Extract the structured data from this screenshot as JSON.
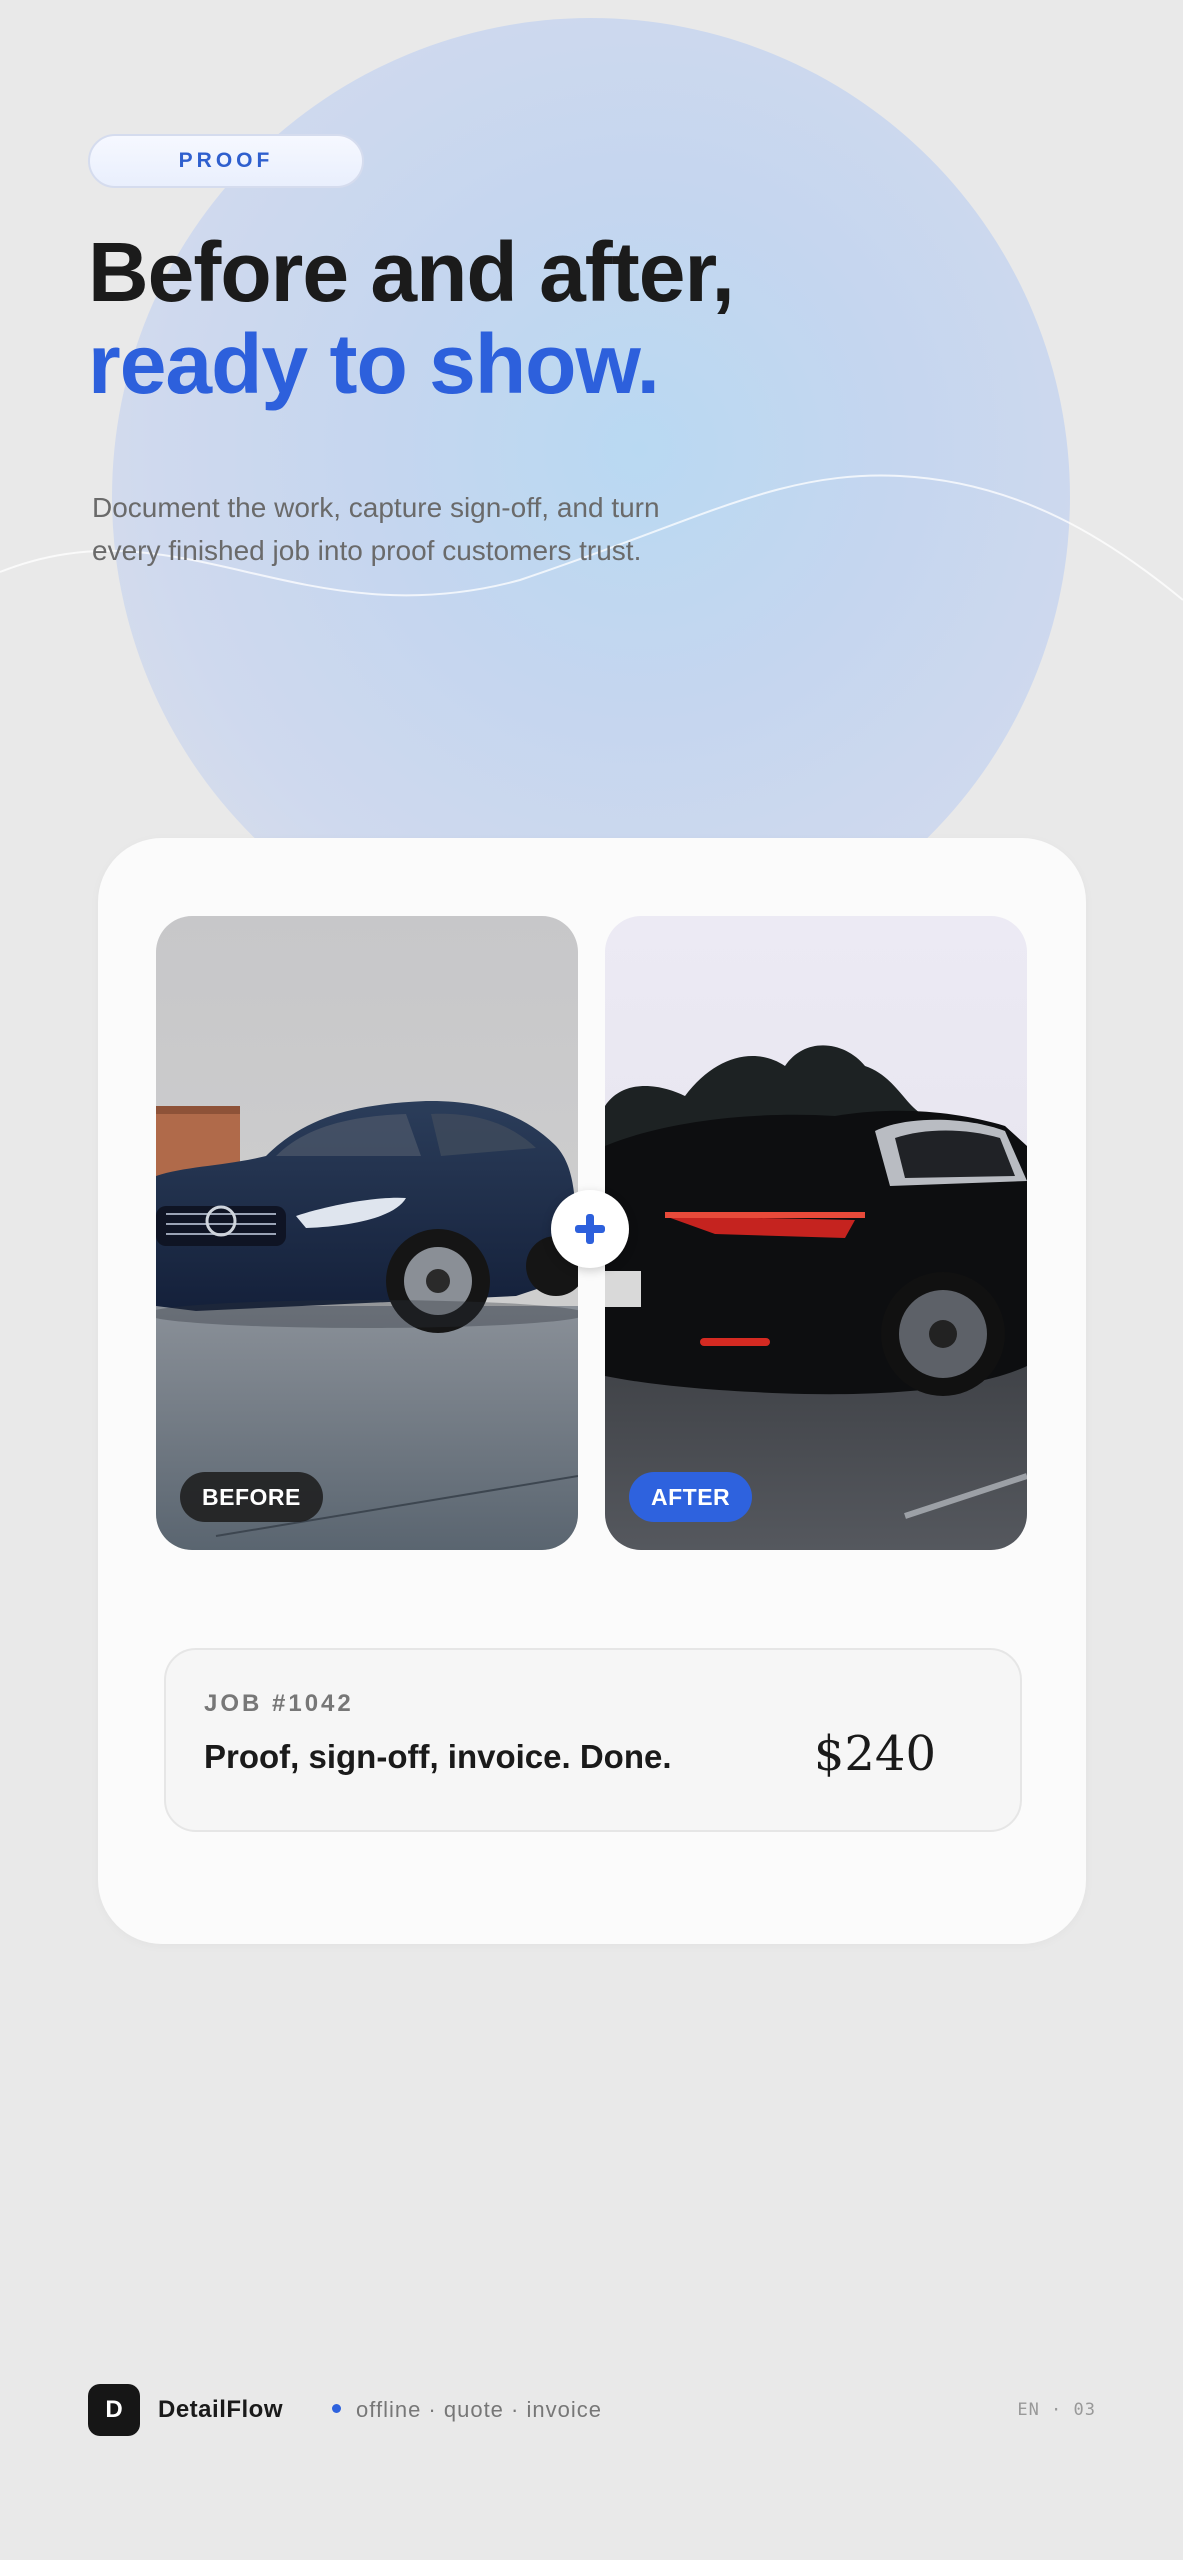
{
  "hero": {
    "badge": "PROOF",
    "headline_line1": "Before and after,",
    "headline_line2": "ready to show.",
    "subtitle_line1": "Document the work, capture sign-off, and turn",
    "subtitle_line2": "every finished job into proof customers trust."
  },
  "comparison": {
    "before_label": "BEFORE",
    "after_label": "AFTER",
    "add_icon": "plus-icon"
  },
  "job": {
    "id": "JOB #1042",
    "summary": "Proof, sign-off, invoice. Done.",
    "price": "$240"
  },
  "footer": {
    "logo_letter": "D",
    "brand": "DetailFlow",
    "tagline": "offline · quote · invoice",
    "locale": "EN · 03"
  },
  "colors": {
    "accent": "#2d60dc",
    "background": "#e9e9e9",
    "card": "#fbfbfb"
  }
}
